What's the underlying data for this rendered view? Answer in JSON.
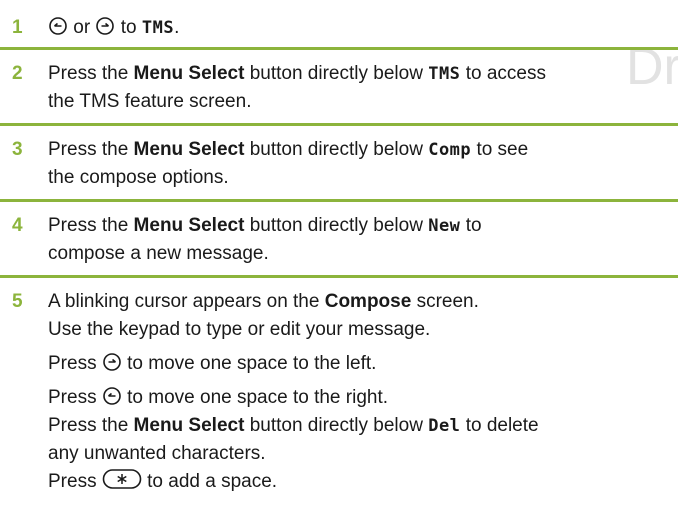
{
  "watermark": "Dr",
  "steps": [
    {
      "num": "1",
      "t_or": "or",
      "t_to": "to",
      "code": "TMS",
      "t_end": "."
    },
    {
      "num": "2",
      "a": "Press the",
      "b": "Menu Select",
      "c": "button directly below",
      "code": "TMS",
      "d": "to access",
      "line2": "the TMS feature screen."
    },
    {
      "num": "3",
      "a": "Press the",
      "b": "Menu Select",
      "c": "button directly below",
      "code": "Comp",
      "d": "to see",
      "line2": "the compose options."
    },
    {
      "num": "4",
      "a": "Press the",
      "b": "Menu Select",
      "c": "button directly below",
      "code": "New",
      "d": "to",
      "line2": "compose a new message."
    },
    {
      "num": "5",
      "l1a": "A blinking cursor appears on the",
      "l1b": "Compose",
      "l1c": "screen.",
      "l2": "Use the keypad to type or edit your message.",
      "l3a": "Press",
      "l3b": "to move one space to the left.",
      "l4a": "Press",
      "l4b": "to move one space to the right.",
      "l5a": "Press the",
      "l5b": "Menu Select",
      "l5c": "button directly below",
      "l5code": "Del",
      "l5d": "to delete",
      "l6": "any unwanted characters.",
      "l7a": "Press",
      "l7b": "to add a space."
    }
  ],
  "icons": [
    "nav-left-icon",
    "nav-right-icon",
    "star-key-icon"
  ],
  "colors": {
    "accent": "#8cb43c",
    "text": "#1a1a1a",
    "watermark": "#e2e2e2"
  }
}
